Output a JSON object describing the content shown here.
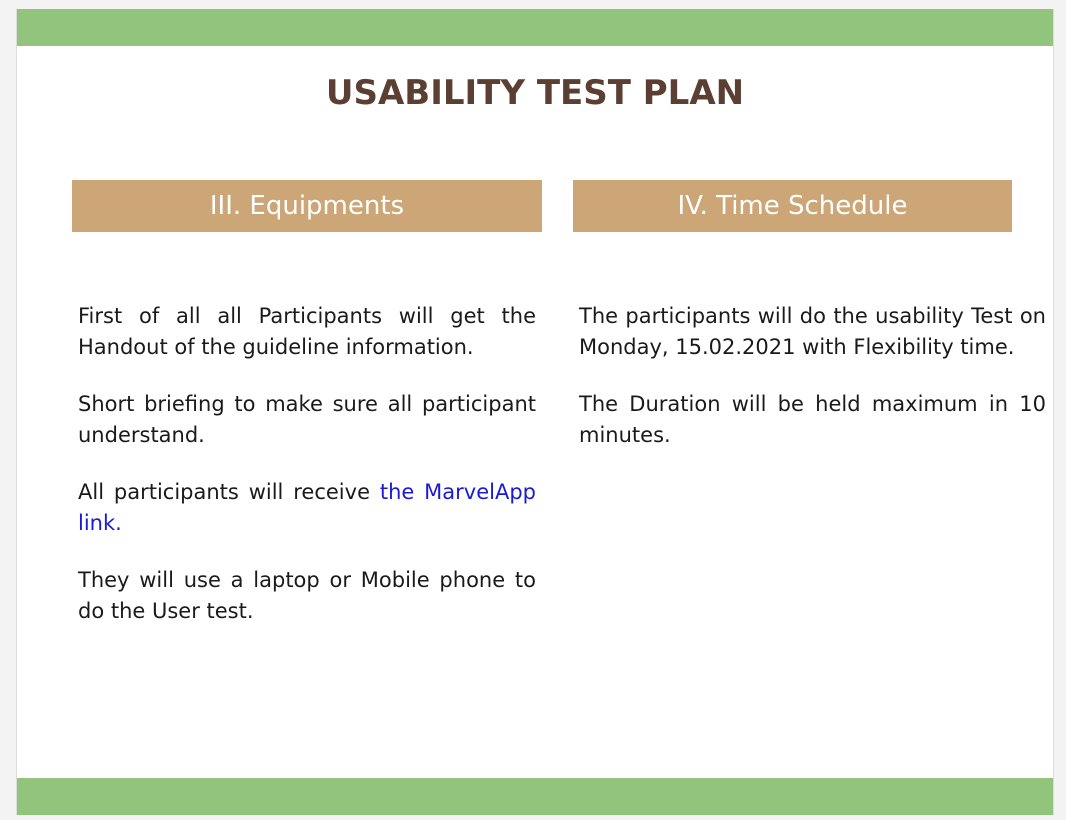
{
  "slide": {
    "title": "USABILITY TEST PLAN",
    "colors": {
      "header_bar": "#cca677",
      "accent_bar": "#93c47d",
      "title": "#5b3f33",
      "link": "#1a1ad6"
    }
  },
  "equipments": {
    "header": "III. Equipments",
    "p1": "First of all all Participants will get the Handout of the guideline information.",
    "p2": "Short briefing  to make sure all participant understand.",
    "p3_prefix": "All participants will receive ",
    "p3_link": "the MarvelApp link.",
    "p4": "They will use a laptop or Mobile phone to do the User test."
  },
  "schedule": {
    "header": "IV. Time Schedule",
    "p1": "The participants will do the usability Test on Monday, 15.02.2021 with Flexibility time.",
    "p2": "The Duration will be held maximum in 10 minutes."
  }
}
